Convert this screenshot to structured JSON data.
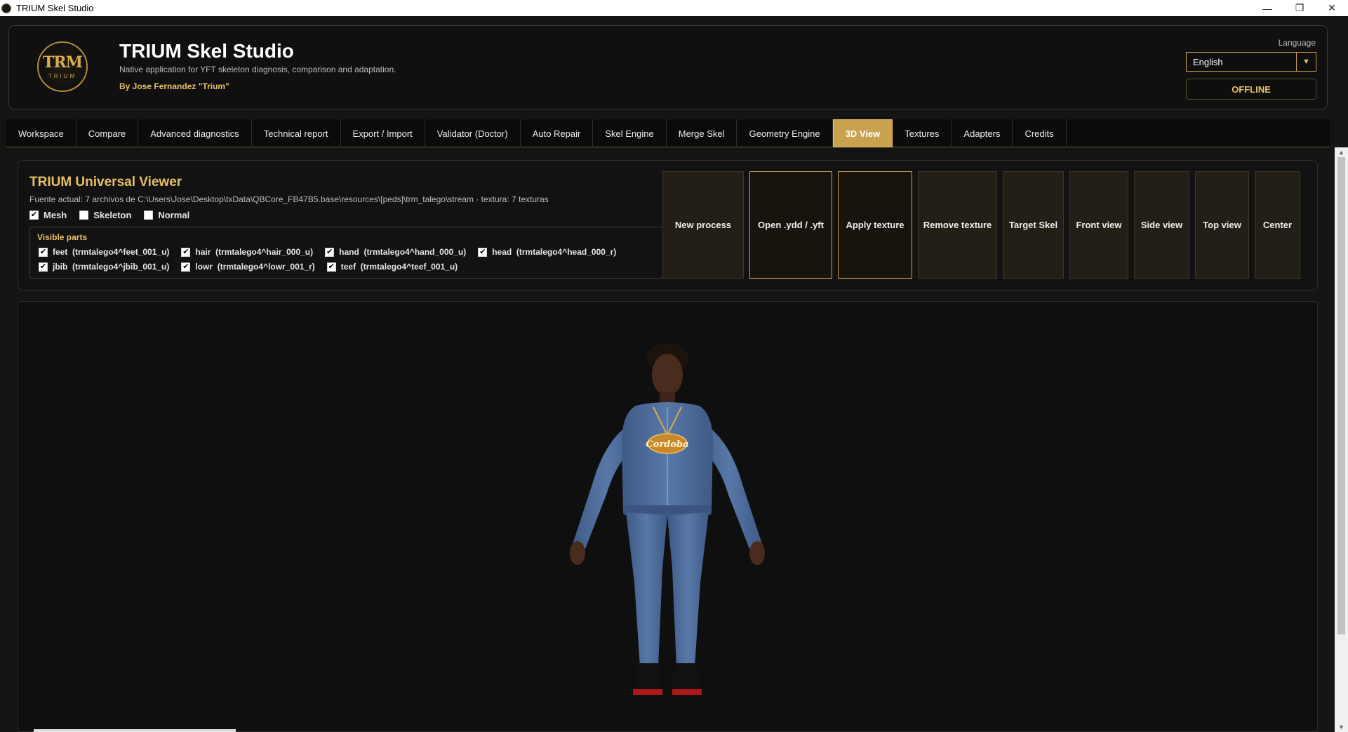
{
  "window": {
    "title": "TRIUM Skel Studio",
    "minimize": "—",
    "restore": "❐",
    "close": "✕"
  },
  "header": {
    "logo_text": "TRM",
    "logo_sub": "TRIUM",
    "title": "TRIUM Skel Studio",
    "subtitle": "Native application for YFT skeleton diagnosis, comparison and adaptation.",
    "author": "By Jose Fernandez \"Trium\"",
    "language_label": "Language",
    "language_value": "English",
    "status": "OFFLINE"
  },
  "tabs": [
    {
      "label": "Workspace",
      "active": false
    },
    {
      "label": "Compare",
      "active": false
    },
    {
      "label": "Advanced diagnostics",
      "active": false
    },
    {
      "label": "Technical report",
      "active": false
    },
    {
      "label": "Export / Import",
      "active": false
    },
    {
      "label": "Validator (Doctor)",
      "active": false
    },
    {
      "label": "Auto Repair",
      "active": false
    },
    {
      "label": "Skel Engine",
      "active": false
    },
    {
      "label": "Merge Skel",
      "active": false
    },
    {
      "label": "Geometry Engine",
      "active": false
    },
    {
      "label": "3D View",
      "active": true
    },
    {
      "label": "Textures",
      "active": false
    },
    {
      "label": "Adapters",
      "active": false
    },
    {
      "label": "Credits",
      "active": false
    }
  ],
  "viewer": {
    "title": "TRIUM Universal Viewer",
    "source": "Fuente actual: 7 archivos de C:\\Users\\Jose\\Desktop\\txData\\QBCore_FB47B5.base\\resources\\[peds]\\trm_talego\\stream  ·  textura: 7 texturas",
    "toggles": [
      {
        "label": "Mesh",
        "checked": true
      },
      {
        "label": "Skeleton",
        "checked": false
      },
      {
        "label": "Normal",
        "checked": false
      }
    ],
    "parts_title": "Visible parts",
    "parts_row1": [
      {
        "label": "feet  (trmtalego4^feet_001_u)",
        "checked": true
      },
      {
        "label": "hair  (trmtalego4^hair_000_u)",
        "checked": true
      },
      {
        "label": "hand  (trmtalego4^hand_000_u)",
        "checked": true
      },
      {
        "label": "head  (trmtalego4^head_000_r)",
        "checked": true
      }
    ],
    "parts_row2": [
      {
        "label": "jbib  (trmtalego4^jbib_001_u)",
        "checked": true
      },
      {
        "label": "lowr  (trmtalego4^lowr_001_r)",
        "checked": true
      },
      {
        "label": "teef  (trmtalego4^teef_001_u)",
        "checked": true
      }
    ],
    "actions": [
      {
        "label": "New process",
        "highlight": false
      },
      {
        "label": "Open .ydd / .yft",
        "highlight": true
      },
      {
        "label": "Apply texture",
        "highlight": true
      },
      {
        "label": "Remove texture",
        "highlight": false
      },
      {
        "label": "Target Skel",
        "highlight": false
      },
      {
        "label": "Front view",
        "highlight": false
      },
      {
        "label": "Side view",
        "highlight": false
      },
      {
        "label": "Top view",
        "highlight": false
      },
      {
        "label": "Center",
        "highlight": false
      }
    ],
    "pendant_text": "Cordoba"
  },
  "colors": {
    "accent": "#c9a24f",
    "accent_text": "#e7c067",
    "background": "#141414",
    "tracksuit": "#4b6a99",
    "skin": "#4a2c1e"
  }
}
